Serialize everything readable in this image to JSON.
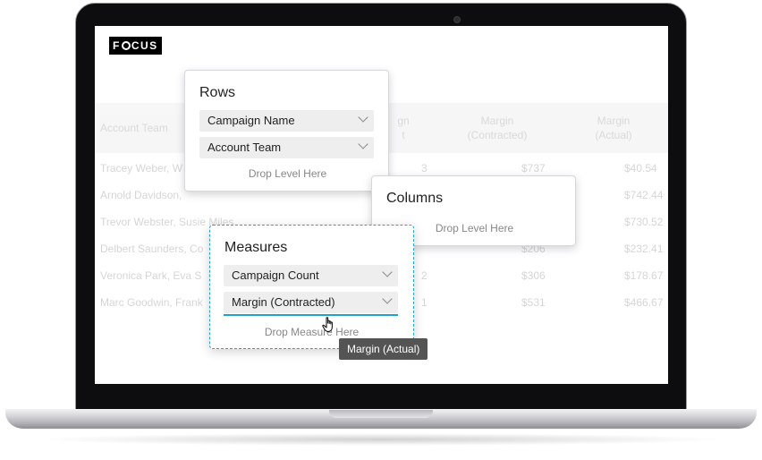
{
  "app": {
    "logo_text": [
      "F",
      "CUS"
    ]
  },
  "table": {
    "headers": [
      {
        "line1": "Account Team",
        "line2": ""
      },
      {
        "line1": "gn",
        "line2": "t"
      },
      {
        "line1": "Margin",
        "line2": "(Contracted)"
      },
      {
        "line1": "Margin",
        "line2": "(Actual)"
      }
    ],
    "rows": [
      {
        "name": "Tracey Weber, W",
        "count": "3",
        "contracted": "$737",
        "actual": "$40.54"
      },
      {
        "name": "Arnold Davidson, ",
        "count": "",
        "contracted": "",
        "actual": "$742.44"
      },
      {
        "name": "Trevor Webster, Susie Miles",
        "count": "",
        "contracted": "",
        "actual": "$730.52"
      },
      {
        "name": "Delbert Saunders, Co",
        "count": "",
        "contracted": "$206",
        "actual": "$232.41"
      },
      {
        "name": "Veronica Park, Eva S",
        "count": "2",
        "contracted": "$306",
        "actual": "$178.67"
      },
      {
        "name": "Marc Goodwin, Frank",
        "count": "1",
        "contracted": "$531",
        "actual": "$466.67"
      }
    ]
  },
  "rows_panel": {
    "title": "Rows",
    "items": [
      "Campaign Name",
      "Account Team"
    ],
    "drop_text": "Drop Level Here"
  },
  "columns_panel": {
    "title": "Columns",
    "drop_text": "Drop Level Here"
  },
  "measures_panel": {
    "title": "Measures",
    "items": [
      "Campaign Count",
      "Margin (Contracted)"
    ],
    "drop_text": "Drop Measure Here"
  },
  "tooltip": {
    "text": "Margin (Actual)"
  },
  "colors": {
    "accent": "#1ea2cf",
    "tooltip_bg": "#545454"
  }
}
